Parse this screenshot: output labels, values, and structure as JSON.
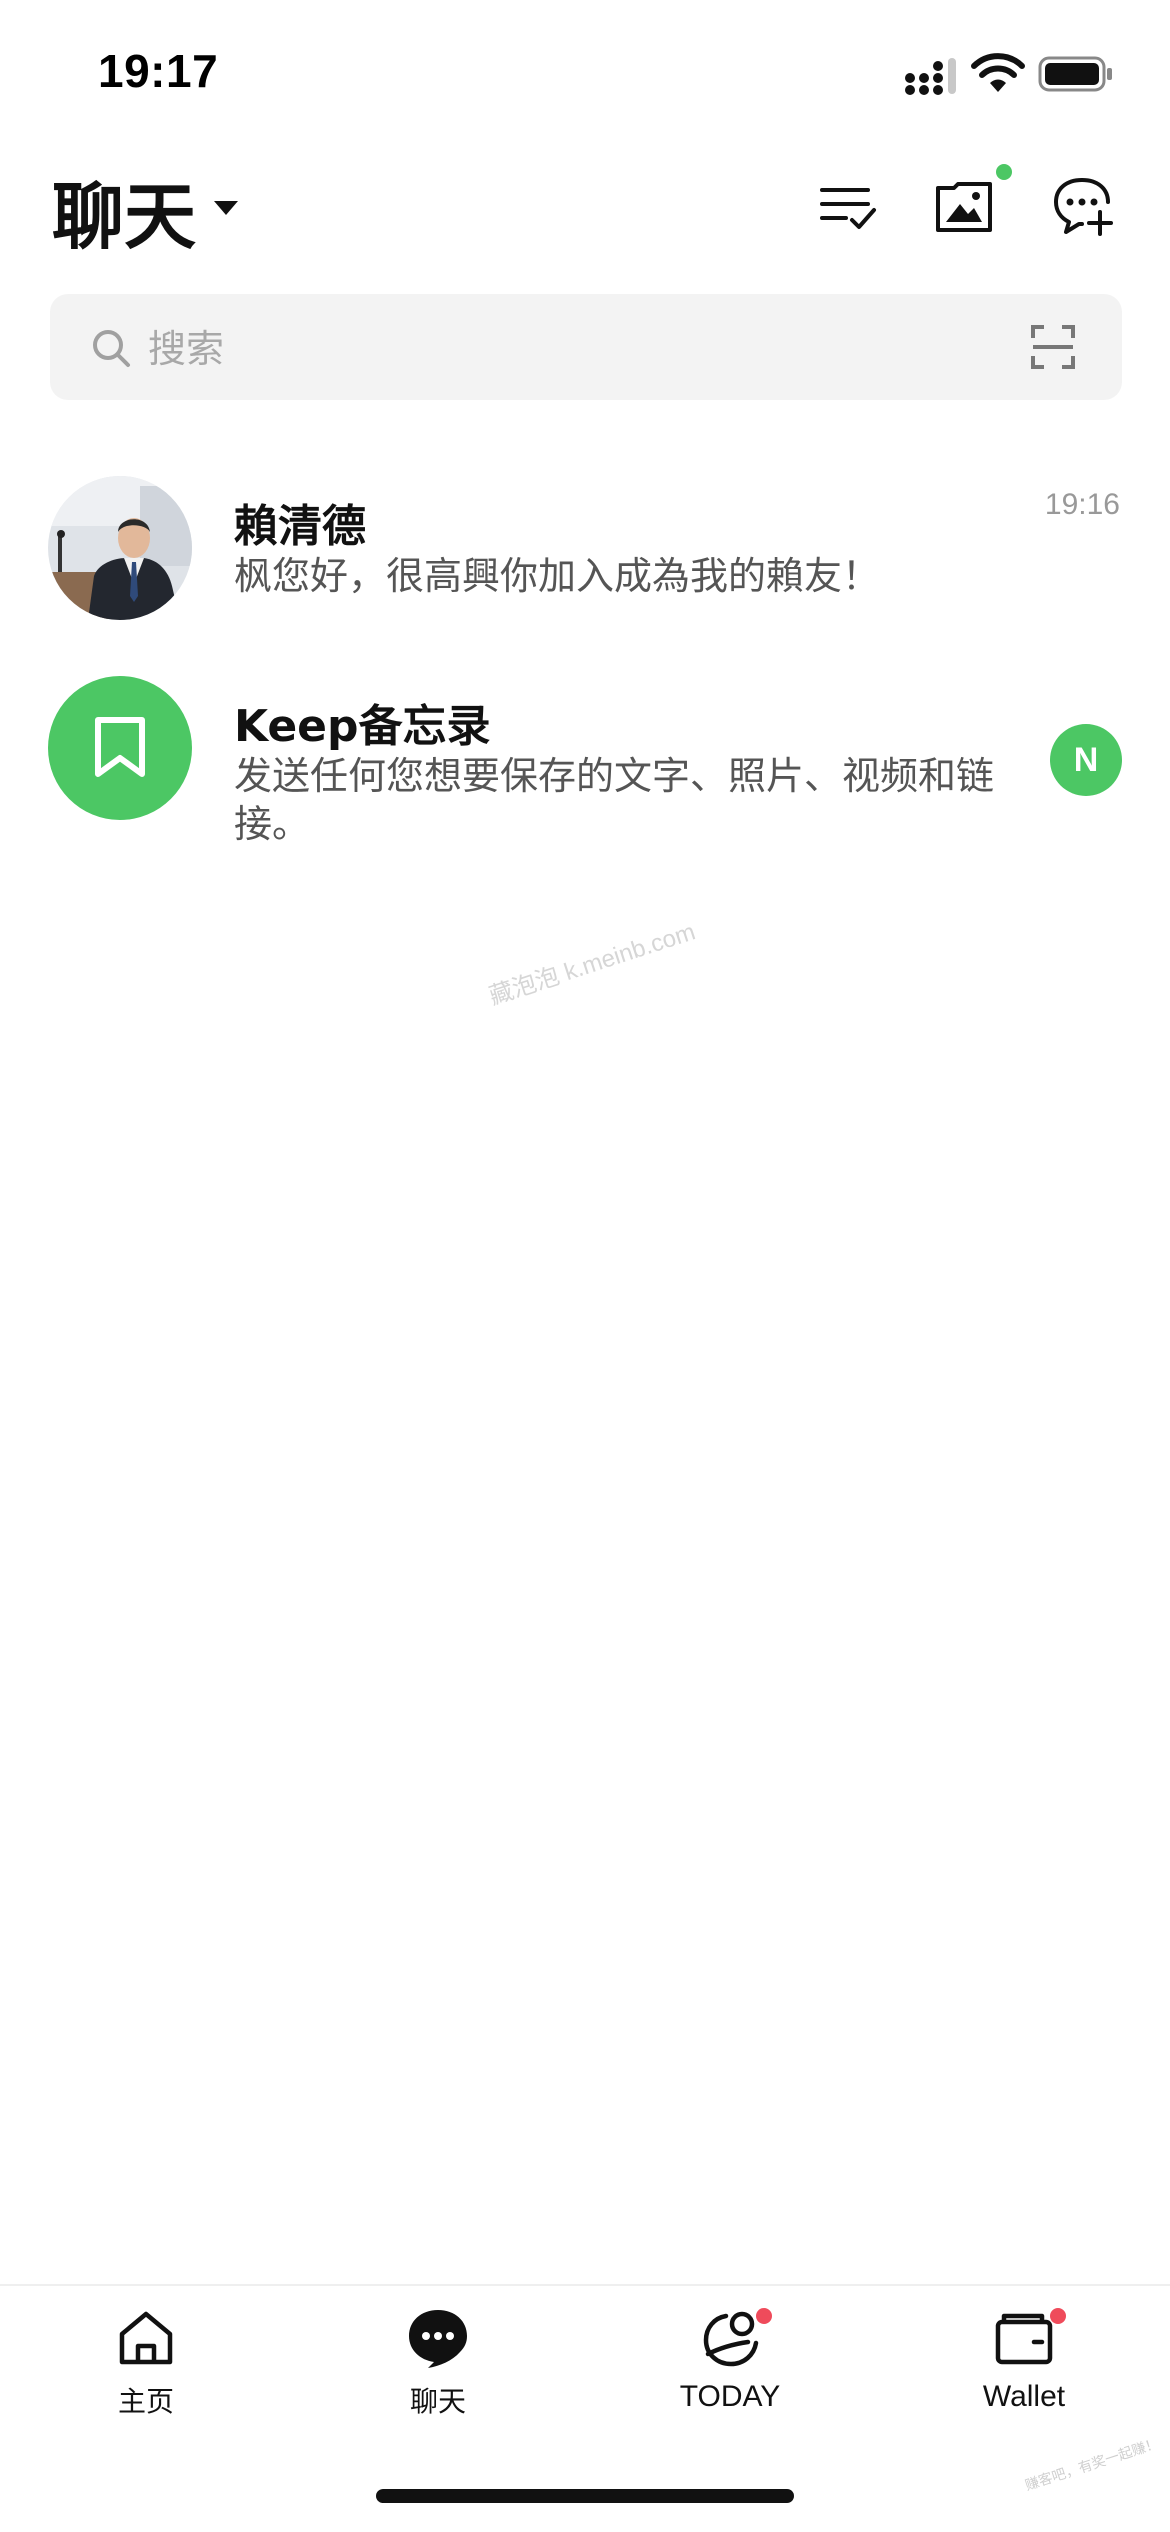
{
  "status_bar": {
    "time": "19:17",
    "icons": [
      "signal-icon",
      "wifi-icon",
      "battery-icon"
    ]
  },
  "header": {
    "title": "聊天",
    "icons": [
      "list-check-icon",
      "album-icon",
      "chat-add-icon"
    ],
    "album_notification": true
  },
  "search": {
    "placeholder": "搜索",
    "scan_icon": "scan-icon"
  },
  "chats": [
    {
      "name": "賴清德",
      "preview": "枫您好，很高興你加入成為我的賴友！",
      "time": "19:16",
      "avatar": "photo"
    },
    {
      "name": "Keep备忘录",
      "preview": "发送任何您想要保存的文字、照片、视频和链接。",
      "badge": "N",
      "avatar": "bookmark-icon"
    }
  ],
  "watermark": "藏泡泡 k.meinb.com",
  "corner_watermark": "赚客吧，有奖一起赚！",
  "tabs": [
    {
      "label": "主页",
      "icon": "home-icon",
      "active": false
    },
    {
      "label": "聊天",
      "icon": "chat-bubble-icon",
      "active": true
    },
    {
      "label": "TODAY",
      "icon": "today-icon",
      "active": false,
      "notification": true
    },
    {
      "label": "Wallet",
      "icon": "wallet-icon",
      "active": false,
      "notification": true
    }
  ],
  "colors": {
    "accent": "#4cc764",
    "notification": "#ef4b5b",
    "search_bg": "#f3f3f3"
  }
}
